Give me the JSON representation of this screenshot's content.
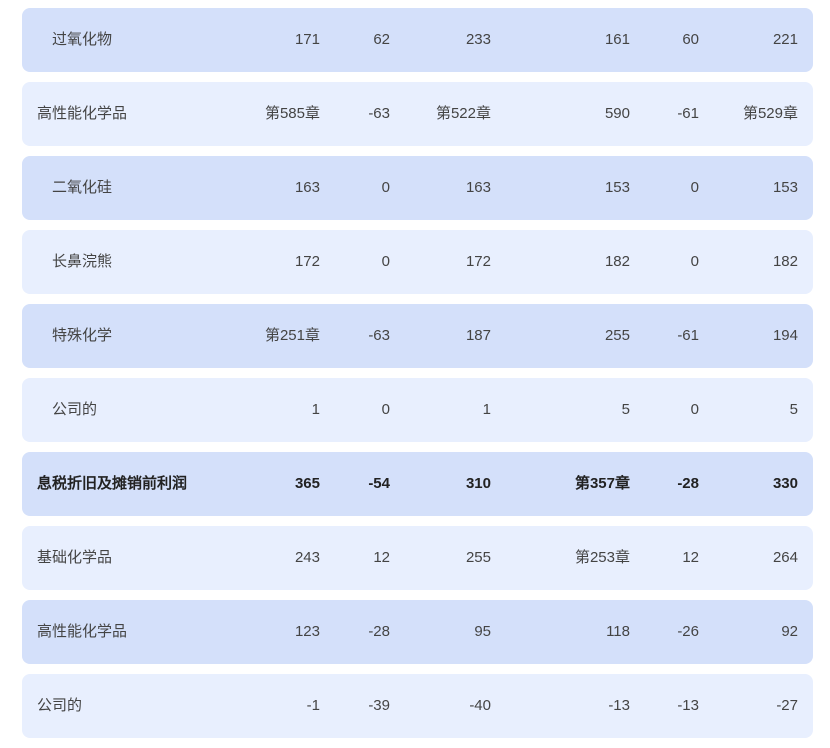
{
  "rows": [
    {
      "label": "过氧化物",
      "indent": true,
      "bold": false,
      "tone": "dark",
      "values": [
        "171",
        "62",
        "233",
        "161",
        "60",
        "221"
      ]
    },
    {
      "label": "高性能化学品",
      "indent": false,
      "bold": false,
      "tone": "light",
      "values": [
        "第585章",
        "-63",
        "第522章",
        "590",
        "-61",
        "第529章"
      ]
    },
    {
      "label": "二氧化硅",
      "indent": true,
      "bold": false,
      "tone": "dark",
      "values": [
        "163",
        "0",
        "163",
        "153",
        "0",
        "153"
      ]
    },
    {
      "label": "长鼻浣熊",
      "indent": true,
      "bold": false,
      "tone": "light",
      "values": [
        "172",
        "0",
        "172",
        "182",
        "0",
        "182"
      ]
    },
    {
      "label": "特殊化学",
      "indent": true,
      "bold": false,
      "tone": "dark",
      "values": [
        "第251章",
        "-63",
        "187",
        "255",
        "-61",
        "194"
      ]
    },
    {
      "label": "公司的",
      "indent": true,
      "bold": false,
      "tone": "light",
      "values": [
        "1",
        "0",
        "1",
        "5",
        "0",
        "5"
      ]
    },
    {
      "label": "息税折旧及摊销前利润",
      "indent": false,
      "bold": true,
      "tone": "dark",
      "values": [
        "365",
        "-54",
        "310",
        "第357章",
        "-28",
        "330"
      ]
    },
    {
      "label": "基础化学品",
      "indent": false,
      "bold": false,
      "tone": "light",
      "values": [
        "243",
        "12",
        "255",
        "第253章",
        "12",
        "264"
      ]
    },
    {
      "label": "高性能化学品",
      "indent": false,
      "bold": false,
      "tone": "dark",
      "values": [
        "123",
        "-28",
        "95",
        "118",
        "-26",
        "92"
      ]
    },
    {
      "label": "公司的",
      "indent": false,
      "bold": false,
      "tone": "light",
      "values": [
        "-1",
        "-39",
        "-40",
        "-13",
        "-13",
        "-27"
      ]
    }
  ]
}
